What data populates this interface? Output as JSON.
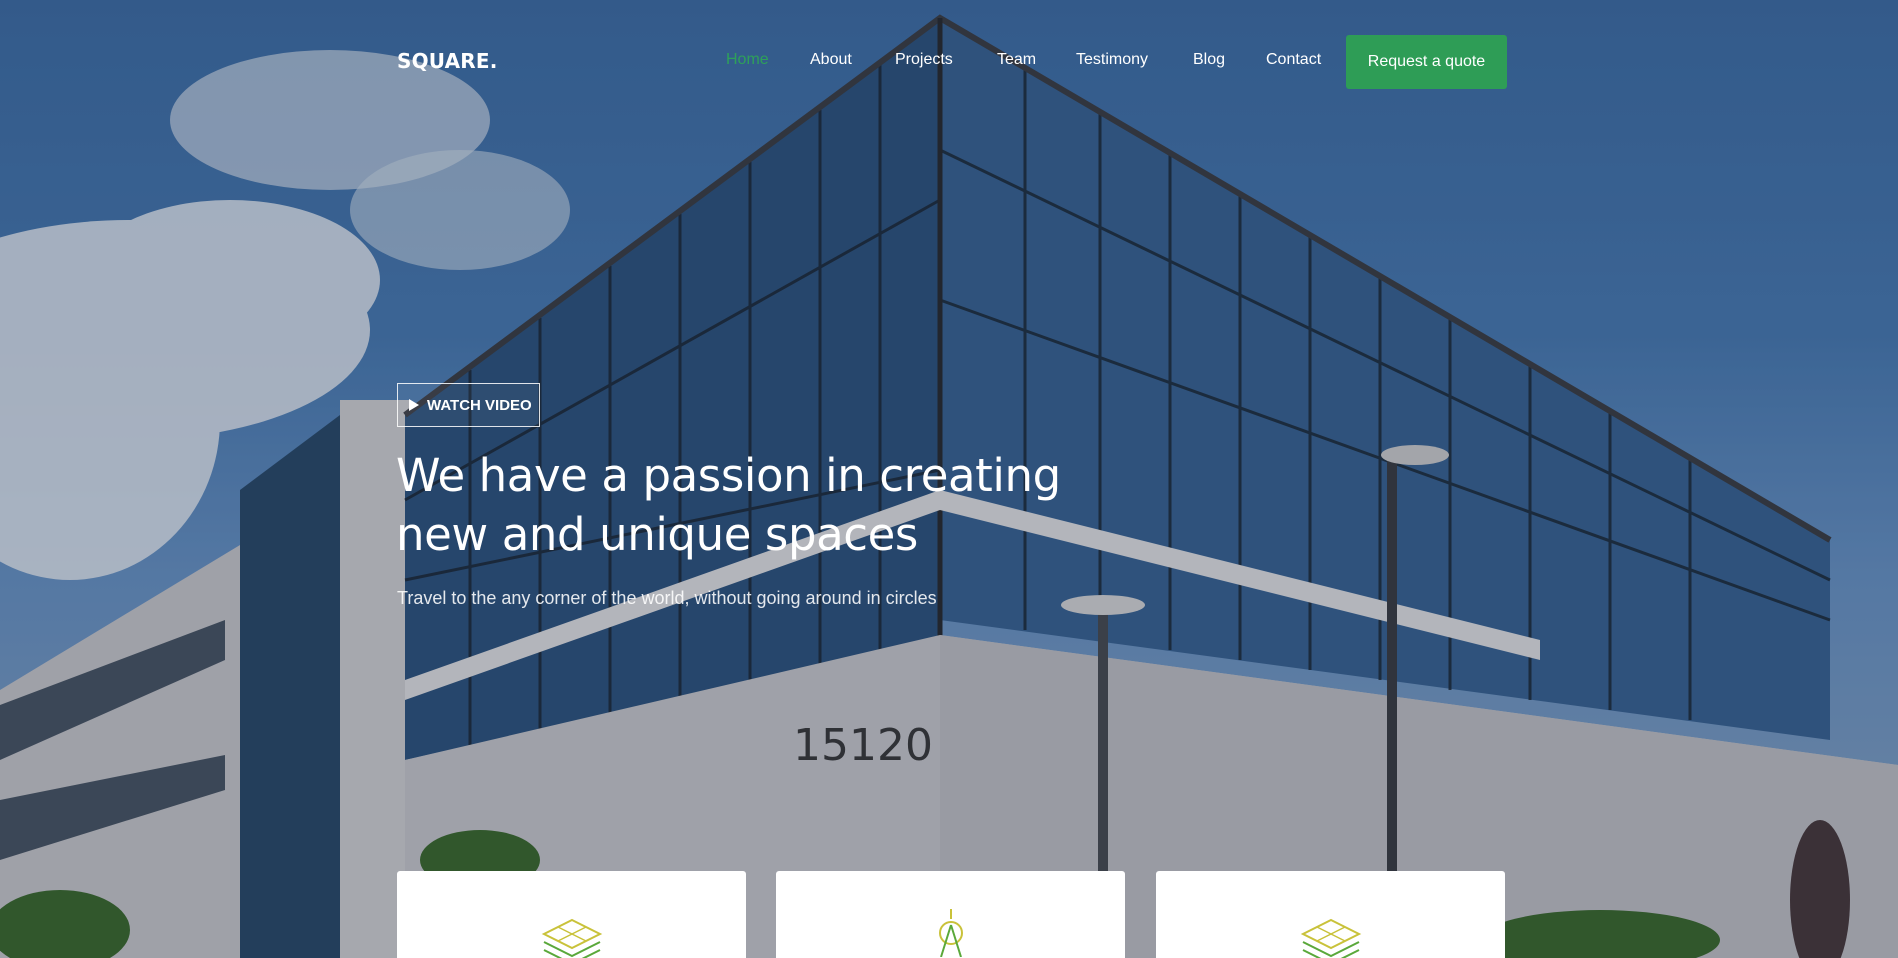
{
  "brand": {
    "logo_text": "SQUARE."
  },
  "nav": {
    "items": [
      {
        "label": "Home",
        "active": true
      },
      {
        "label": "About"
      },
      {
        "label": "Projects"
      },
      {
        "label": "Team"
      },
      {
        "label": "Testimony"
      },
      {
        "label": "Blog"
      },
      {
        "label": "Contact"
      }
    ],
    "cta_label": "Request a quote"
  },
  "hero": {
    "video_button_label": "WATCH VIDEO",
    "headline_line1": "We have a passion in creating",
    "headline_line2": "new and unique spaces",
    "subtext": "Travel to the any corner of the world, without going around in circles",
    "building_number": "15120"
  },
  "cards": [
    {
      "icon": "layers-icon"
    },
    {
      "icon": "compass-icon"
    },
    {
      "icon": "layers-icon"
    }
  ],
  "colors": {
    "accent": "#2e9d56",
    "active_nav": "#2ea05a",
    "card_icon_green": "#5aa83a",
    "card_icon_yellow": "#c9c23a"
  }
}
